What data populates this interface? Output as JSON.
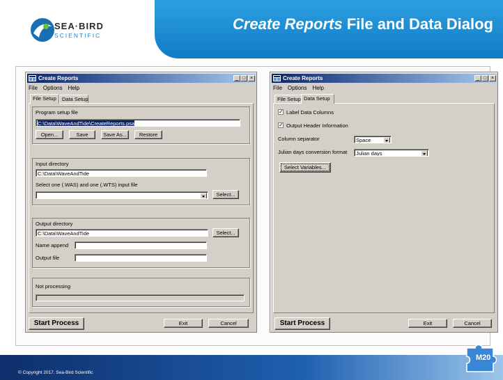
{
  "slide": {
    "title_italic": "Create Reports",
    "title_rest": " File and Data Dialog",
    "logo_line1": "SEA·BIRD",
    "logo_line2": "SCIENTIFIC",
    "copyright": "© Copyright 2017. Sea-Bird Scientific",
    "badge": "M20"
  },
  "left_window": {
    "title": "Create Reports",
    "min": "_",
    "max": "□",
    "close": "×",
    "menu": [
      "File",
      "Options",
      "Help"
    ],
    "tabs": [
      "File Setup",
      "Data Setup"
    ],
    "program_group_label": "Program setup file",
    "program_path": "C:\\Data\\WaveAndTide\\CreateReports.psa",
    "buttons": {
      "open": "Open...",
      "save": "Save",
      "save_as": "Save As...",
      "restore": "Restore"
    },
    "input_dir_label": "Input directory",
    "input_dir": "C:\\Data\\WaveAndTide",
    "select_input_label": "Select one (.WAS) and one (.WTS) input file",
    "select_input_value": "",
    "select_btn": "Select...",
    "output_dir_label": "Output directory",
    "output_dir": "C:\\Data\\WaveAndTide",
    "output_select_btn": "Select...",
    "name_append_label": "Name append",
    "name_append": "",
    "output_file_label": "Output file",
    "output_file": "",
    "status": "Not processing",
    "start": "Start Process",
    "exit": "Exit",
    "cancel": "Cancel"
  },
  "right_window": {
    "title": "Create Reports",
    "min": "_",
    "max": "□",
    "close": "×",
    "menu": [
      "File",
      "Options",
      "Help"
    ],
    "tabs": [
      "File Setup",
      "Data Setup"
    ],
    "label_data_columns": "Label Data Columns",
    "output_header": "Output Header Information",
    "check_mark": "✓",
    "column_sep_label": "Column separator",
    "column_sep": "Space",
    "julian_label": "Julian days conversion format",
    "julian": "Julian days",
    "select_vars": "Select Variables...",
    "start": "Start Process",
    "exit": "Exit",
    "cancel": "Cancel"
  }
}
